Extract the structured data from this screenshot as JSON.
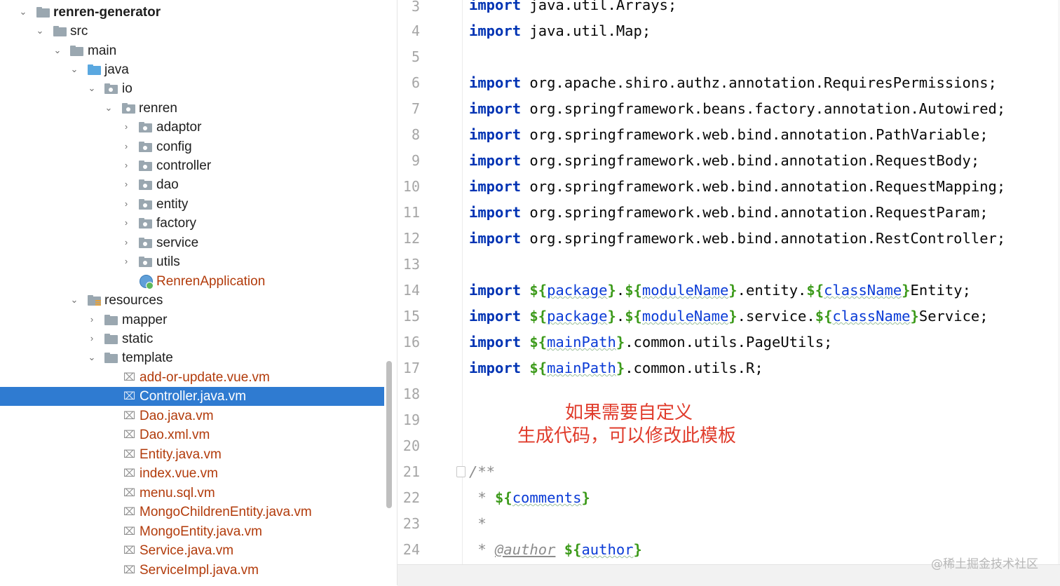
{
  "project_tree": {
    "root": "renren-generator",
    "src": "src",
    "main": "main",
    "java": "java",
    "io": "io",
    "renren": "renren",
    "packages": [
      "adaptor",
      "config",
      "controller",
      "dao",
      "entity",
      "factory",
      "service",
      "utils"
    ],
    "app_class": "RenrenApplication",
    "resources": "resources",
    "res_folders": [
      "mapper",
      "static",
      "template"
    ],
    "template_files": [
      "add-or-update.vue.vm",
      "Controller.java.vm",
      "Dao.java.vm",
      "Dao.xml.vm",
      "Entity.java.vm",
      "index.vue.vm",
      "menu.sql.vm",
      "MongoChildrenEntity.java.vm",
      "MongoEntity.java.vm",
      "Service.java.vm",
      "ServiceImpl.java.vm"
    ],
    "selected_file": "Controller.java.vm"
  },
  "editor": {
    "line_numbers": [
      "3",
      "4",
      "5",
      "6",
      "7",
      "8",
      "9",
      "10",
      "11",
      "12",
      "13",
      "14",
      "15",
      "16",
      "17",
      "18",
      "19",
      "20",
      "21",
      "22",
      "23",
      "24"
    ],
    "lines": {
      "l3_kw": "import",
      "l3_rest": " java.util.Arrays;",
      "l4_kw": "import",
      "l4_rest": " java.util.Map;",
      "l6_kw": "import",
      "l6_rest": " org.apache.shiro.authz.annotation.RequiresPermissions;",
      "l7_kw": "import",
      "l7_rest": " org.springframework.beans.factory.annotation.Autowired;",
      "l8_kw": "import",
      "l8_rest": " org.springframework.web.bind.annotation.PathVariable;",
      "l9_kw": "import",
      "l9_rest": " org.springframework.web.bind.annotation.RequestBody;",
      "l10_kw": "import",
      "l10_rest": " org.springframework.web.bind.annotation.RequestMapping;",
      "l11_kw": "import",
      "l11_rest": " org.springframework.web.bind.annotation.RequestParam;",
      "l12_kw": "import",
      "l12_rest": " org.springframework.web.bind.annotation.RestController;",
      "l14": {
        "kw": "import",
        "a": "package",
        "b": "moduleName",
        "mid": ".entity.",
        "c": "className",
        "end": "Entity;"
      },
      "l15": {
        "kw": "import",
        "a": "package",
        "b": "moduleName",
        "mid": ".service.",
        "c": "className",
        "end": "Service;"
      },
      "l16": {
        "kw": "import",
        "a": "mainPath",
        "end": ".common.utils.PageUtils;"
      },
      "l17": {
        "kw": "import",
        "a": "mainPath",
        "end": ".common.utils.R;"
      },
      "l21": "/**",
      "l22": {
        "star": " * ",
        "var": "comments"
      },
      "l23": " *",
      "l24": {
        "star": " * ",
        "tag": "@author",
        "var": "author"
      }
    },
    "annotation_line1": "如果需要自定义",
    "annotation_line2": "生成代码，可以修改此模板"
  },
  "watermark": "@稀土掘金技术社区",
  "colors": {
    "selection": "#2f7bd1",
    "keyword": "#0033b3",
    "template_delim": "#3c9a1a",
    "template_var": "#0a3bd6",
    "vm_file": "#b23b0b",
    "annotation": "#e03c2c"
  }
}
